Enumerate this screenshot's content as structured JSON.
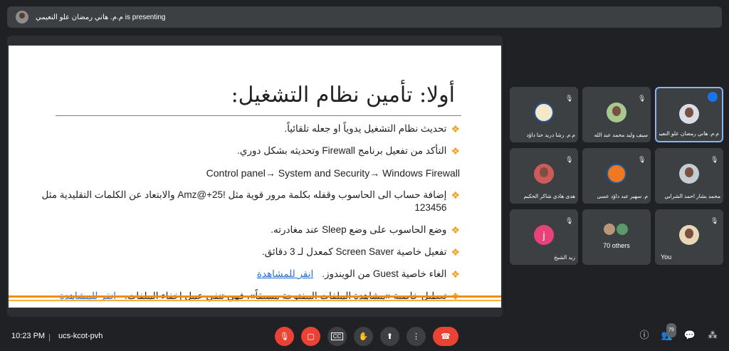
{
  "header": {
    "presenter_text": "م.م. هاني رمضان علو النعيمي is presenting"
  },
  "slide": {
    "title": "أولا: تأمين نظام التشغيل:",
    "bullets": [
      {
        "text": "تحديث نظام التشغيل يدوياً او جعله تلقائياً.",
        "marker": true
      },
      {
        "text": "التأكد من تفعيل برنامج Firewall وتحديثه بشكل دوري.",
        "marker": true
      },
      {
        "text": "Control panel→ System and Security→ Windows Firewall",
        "marker": false
      },
      {
        "text": "إضافة حساب الى الحاسوب وقفله بكلمة مرور قوية مثل !Amz@+25 والابتعاد عن الكلمات التقليدية مثل 123456",
        "marker": true
      },
      {
        "text": "وضع الحاسوب على وضع Sleep عند مغادرته.",
        "marker": true
      },
      {
        "text": "تفعيل خاصية Screen Saver كمعدل لـ 3 دقائق.",
        "marker": true
      },
      {
        "text": "الغاء خاصية Guest من الويندوز.",
        "marker": true,
        "link": "انقر للمشاهدة"
      },
      {
        "text": "تعطيل خاصية «مشاهدة الملفات المفتوحة مسبقاً»، فهي تنفي عمل إخفاء الملفات.",
        "marker": true,
        "link": "انقر للمشاهدة"
      }
    ]
  },
  "participants": [
    {
      "name": "م.م. رشا دريد حنا داؤد",
      "avatar": "logo-icon"
    },
    {
      "name": "سيف وليد محمد عبد الله",
      "avatar": "photo"
    },
    {
      "name": "م.م. هاني رمضان علو النعيمي",
      "avatar": "photo",
      "speaking": true
    },
    {
      "name": "هدى هادي شاكر الحكيم",
      "avatar": "photo"
    },
    {
      "name": "م. سهير عبد داؤد عسى",
      "avatar": "logo-icon"
    },
    {
      "name": "محمد بشار احمد الشرابي",
      "avatar": "photo"
    },
    {
      "name": "زيد الشيخ",
      "avatar": "letter",
      "letter": "j"
    },
    {
      "name": "70 others",
      "avatar": "group"
    },
    {
      "name": "You",
      "avatar": "photo"
    }
  ],
  "bottom": {
    "time": "10:23 PM",
    "separator": "|",
    "meeting_code": "ucs-kcot-pvh",
    "people_count": "79"
  },
  "colors": {
    "accent_red": "#ea4335",
    "speaking_blue": "#1a73e8",
    "slide_orange": "#f08c14"
  }
}
